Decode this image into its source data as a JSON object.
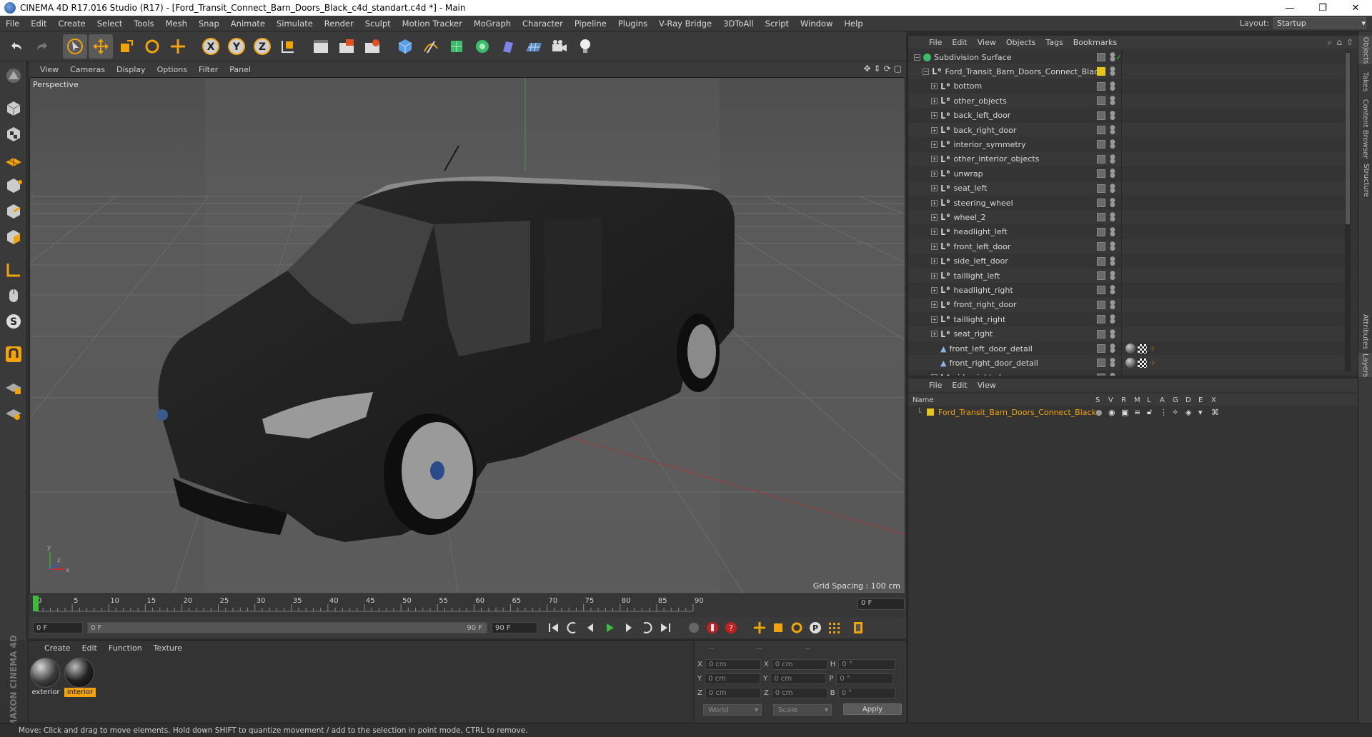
{
  "window": {
    "title": "CINEMA 4D R17.016 Studio (R17) - [Ford_Transit_Connect_Barn_Doors_Black_c4d_standart.c4d *] - Main",
    "minimize": "—",
    "maximize": "❐",
    "close": "✕"
  },
  "menu": {
    "items": [
      "File",
      "Edit",
      "Create",
      "Select",
      "Tools",
      "Mesh",
      "Snap",
      "Animate",
      "Simulate",
      "Render",
      "Sculpt",
      "Motion Tracker",
      "MoGraph",
      "Character",
      "Pipeline",
      "Plugins",
      "V-Ray Bridge",
      "3DToAll",
      "Script",
      "Window",
      "Help"
    ],
    "layout_label": "Layout:",
    "layout_value": "Startup"
  },
  "viewport": {
    "menu": [
      "View",
      "Cameras",
      "Display",
      "Options",
      "Filter",
      "Panel"
    ],
    "label": "Perspective",
    "grid_spacing": "Grid Spacing : 100 cm",
    "axis_labels": {
      "x": "x",
      "y": "y",
      "z": "z"
    }
  },
  "timeline": {
    "ticks": [
      "0",
      "5",
      "10",
      "15",
      "20",
      "25",
      "30",
      "35",
      "40",
      "45",
      "50",
      "55",
      "60",
      "65",
      "70",
      "75",
      "80",
      "85",
      "90"
    ],
    "current_frame": "0 F",
    "start_field": "0 F",
    "range_start": "0 F",
    "range_end": "90 F",
    "end_field": "90 F"
  },
  "material_manager": {
    "menu": [
      "Create",
      "Edit",
      "Function",
      "Texture"
    ],
    "materials": [
      {
        "name": "exterior",
        "selected": false
      },
      {
        "name": "interior",
        "selected": true
      }
    ]
  },
  "coordinates": {
    "header": [
      "--",
      "--",
      "--"
    ],
    "rows": [
      {
        "axis": "X",
        "pos": "0 cm",
        "axis2": "X",
        "size": "0 cm",
        "axis3": "H",
        "rot": "0 °"
      },
      {
        "axis": "Y",
        "pos": "0 cm",
        "axis2": "Y",
        "size": "0 cm",
        "axis3": "P",
        "rot": "0 °"
      },
      {
        "axis": "Z",
        "pos": "0 cm",
        "axis2": "Z",
        "size": "0 cm",
        "axis3": "B",
        "rot": "0 °"
      }
    ],
    "mode1": "World",
    "mode2": "Scale",
    "apply": "Apply"
  },
  "object_manager": {
    "menu": [
      "File",
      "Edit",
      "View",
      "Objects",
      "Tags",
      "Bookmarks"
    ],
    "objects": [
      {
        "name": "Subdivision Surface",
        "level": 0,
        "icon": "subdiv"
      },
      {
        "name": "Ford_Transit_Barn_Doors_Connect_Black",
        "level": 1,
        "icon": "null"
      },
      {
        "name": "bottom",
        "level": 2,
        "icon": "null"
      },
      {
        "name": "other_objects",
        "level": 2,
        "icon": "null"
      },
      {
        "name": "back_left_door",
        "level": 2,
        "icon": "null"
      },
      {
        "name": "back_right_door",
        "level": 2,
        "icon": "null"
      },
      {
        "name": "interior_symmetry",
        "level": 2,
        "icon": "null"
      },
      {
        "name": "other_interior_objects",
        "level": 2,
        "icon": "null"
      },
      {
        "name": "unwrap",
        "level": 2,
        "icon": "null"
      },
      {
        "name": "seat_left",
        "level": 2,
        "icon": "null"
      },
      {
        "name": "steering_wheel",
        "level": 2,
        "icon": "null"
      },
      {
        "name": "wheel_2",
        "level": 2,
        "icon": "null"
      },
      {
        "name": "headlight_left",
        "level": 2,
        "icon": "null"
      },
      {
        "name": "front_left_door",
        "level": 2,
        "icon": "null"
      },
      {
        "name": "side_left_door",
        "level": 2,
        "icon": "null"
      },
      {
        "name": "taillight_left",
        "level": 2,
        "icon": "null"
      },
      {
        "name": "headlight_right",
        "level": 2,
        "icon": "null"
      },
      {
        "name": "front_right_door",
        "level": 2,
        "icon": "null"
      },
      {
        "name": "taillight_right",
        "level": 2,
        "icon": "null"
      },
      {
        "name": "seat_right",
        "level": 2,
        "icon": "null"
      },
      {
        "name": "front_left_door_detail",
        "level": 2,
        "icon": "poly"
      },
      {
        "name": "front_right_door_detail",
        "level": 2,
        "icon": "poly"
      },
      {
        "name": "side_right_door",
        "level": 2,
        "icon": "null"
      }
    ]
  },
  "layer_manager": {
    "menu": [
      "File",
      "Edit",
      "View"
    ],
    "columns": [
      "Name",
      "S",
      "V",
      "R",
      "M",
      "L",
      "A",
      "G",
      "D",
      "E",
      "X"
    ],
    "layers": [
      {
        "name": "Ford_Transit_Barn_Doors_Connect_Black",
        "color": "#e8c619"
      }
    ]
  },
  "side_tabs": [
    "Objects",
    "Takes",
    "Content Browser",
    "Structure",
    "Attributes",
    "Layers"
  ],
  "status": "Move: Click and drag to move elements. Hold down SHIFT to quantize movement / add to the selection in point mode, CTRL to remove.",
  "brand": "MAXON CINEMA 4D",
  "colors": {
    "accent": "#f0a30a",
    "layer": "#e8c619",
    "selection": "#f0a30a"
  }
}
